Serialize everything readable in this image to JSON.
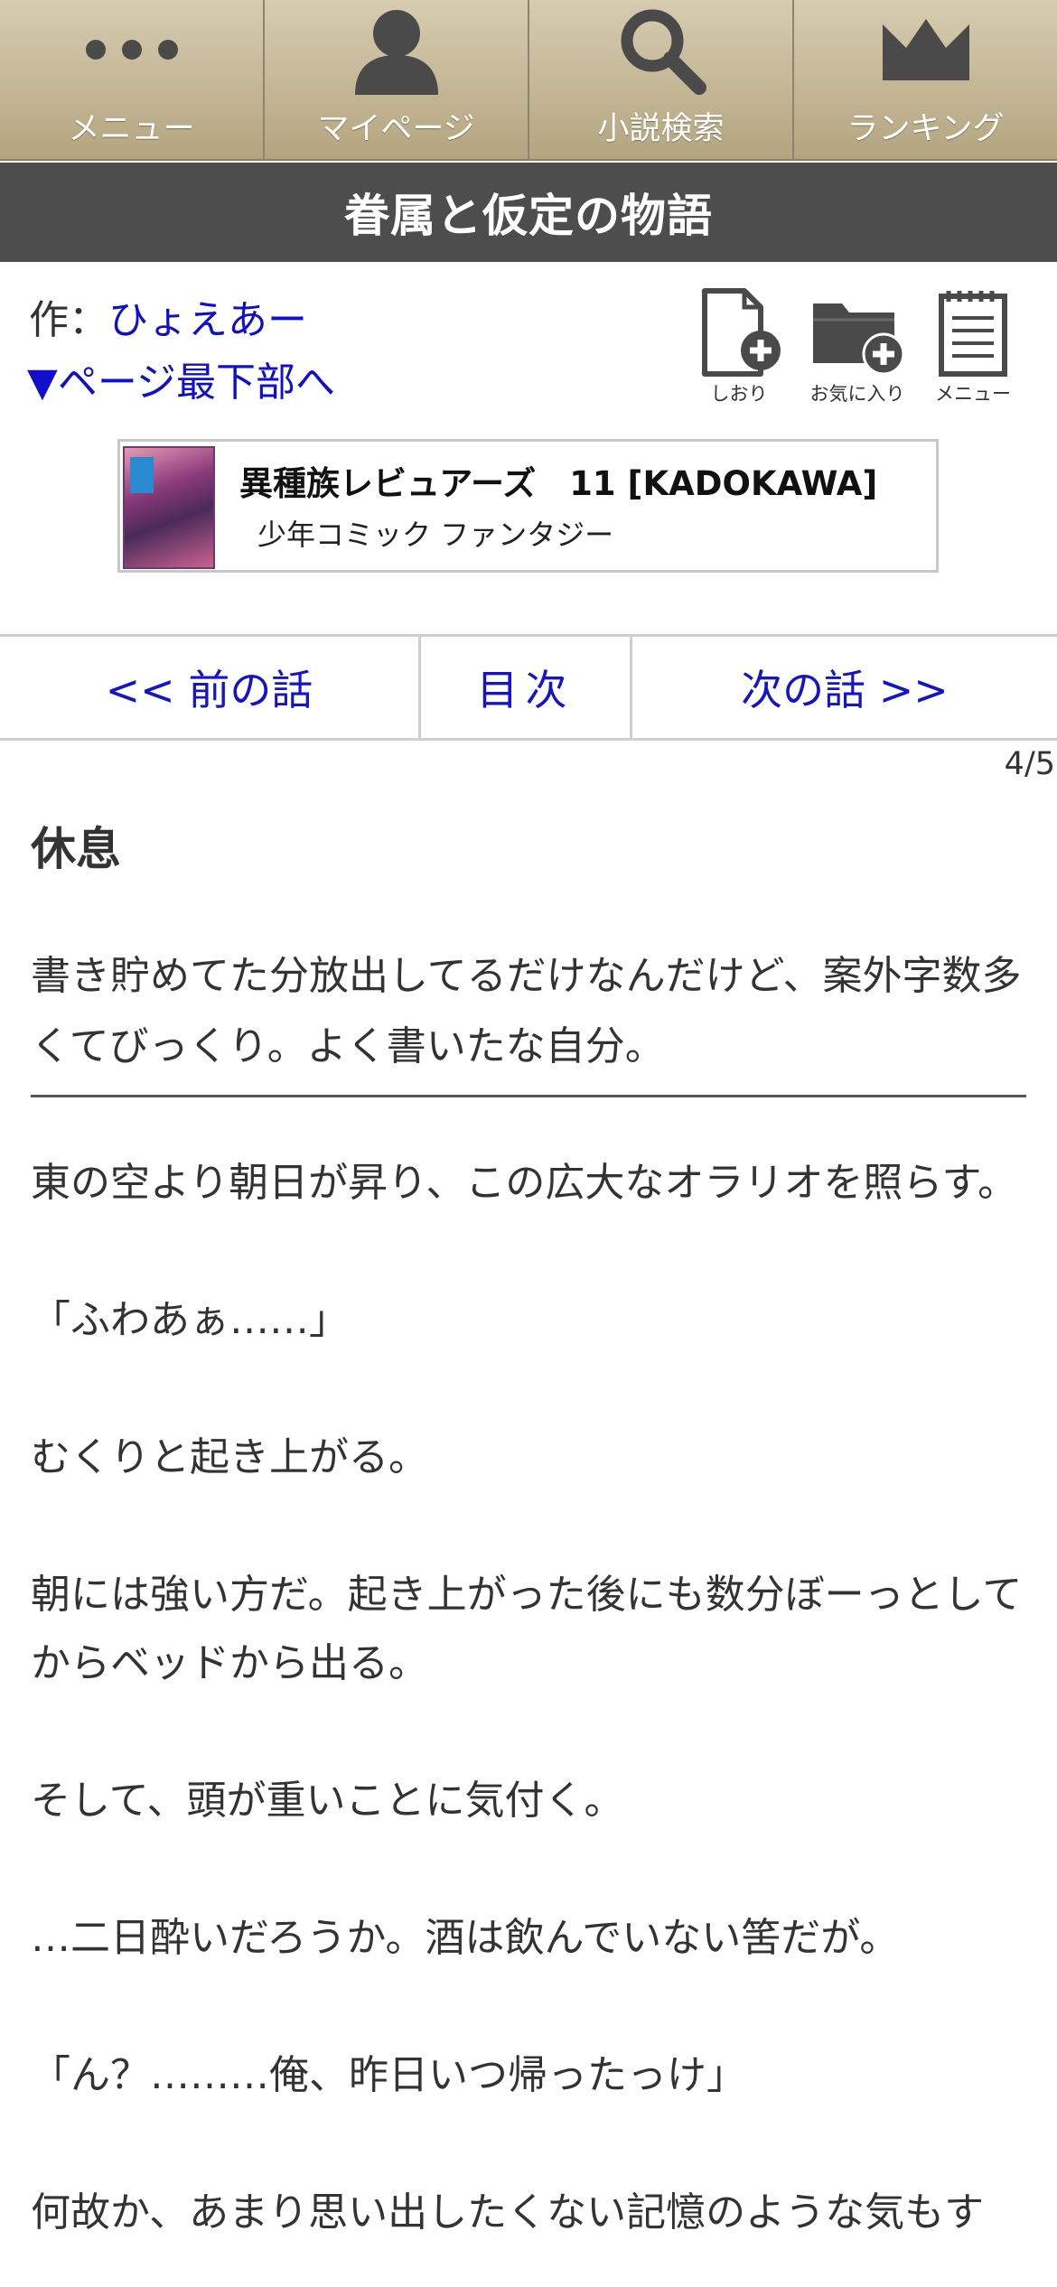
{
  "nav": {
    "menu": "メニュー",
    "mypage": "マイページ",
    "search": "小説検索",
    "ranking": "ランキング"
  },
  "novel_title": "眷属と仮定の物語",
  "author": {
    "prefix": "作：",
    "name": "ひょえあー"
  },
  "jump_bottom": "▼ページ最下部へ",
  "tools": {
    "bookmark": "しおり",
    "favorite": "お気に入り",
    "menu": "メニュー"
  },
  "ad": {
    "title": "異種族レビュアーズ　11 [KADOKAWA]",
    "genre": "少年コミック ファンタジー"
  },
  "chapter_nav": {
    "prev": "<< 前の話",
    "toc": "目次",
    "next": "次の話 >>"
  },
  "page_number": "4/5",
  "chapter_title": "休息",
  "preface": "書き貯めてた分放出してるだけなんだけど、案外字数多くてびっくり。よく書いたな自分。",
  "paragraphs": [
    "東の空より朝日が昇り、この広大なオラリオを照らす。",
    "",
    "「ふわあぁ……」",
    "",
    "むくりと起き上がる。",
    "",
    "朝には強い方だ。起き上がった後にも数分ぼーっとしてからベッドから出る。",
    "",
    "そして、頭が重いことに気付く。",
    "",
    "…二日酔いだろうか。酒は飲んでいない筈だが。",
    "",
    "「ん？………俺、昨日いつ帰ったっけ」",
    "",
    "何故か、あまり思い出したくない記憶のような気もす"
  ],
  "colors": {
    "nav_bg": "#c4b796",
    "title_bg": "#4d4d4d",
    "link": "#1515c8"
  }
}
